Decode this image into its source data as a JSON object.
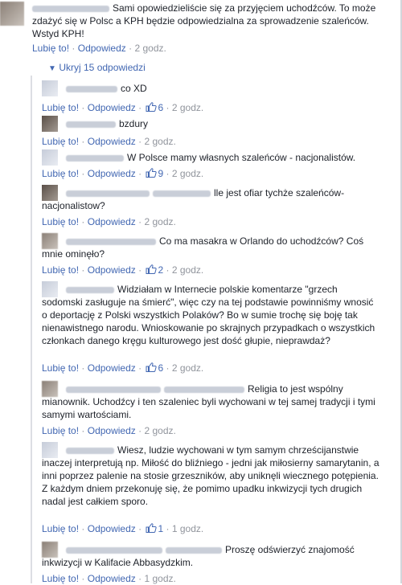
{
  "top_comment": {
    "text": "Sami opowiedzieliście się za przyjęciem uchodźców. To może zdażyć się w Polsc a KPH będzie odpowiedzialna za sprowadzenie szaleńców. Wstyd KPH!",
    "like": "Lubię to!",
    "reply": "Odpowiedz",
    "time": "2 godz."
  },
  "toggle": {
    "label": "Ukryj 15 odpowiedzi"
  },
  "actions": {
    "like": "Lubię to!",
    "reply": "Odpowiedz",
    "separator": "·"
  },
  "replies": [
    {
      "text": "co XD",
      "likes": "6",
      "time": "2 godz."
    },
    {
      "text": "bzdury",
      "likes": "",
      "time": "2 godz."
    },
    {
      "text": "W Polsce mamy własnych szaleńców - nacjonalistów.",
      "likes": "9",
      "time": "2 godz."
    },
    {
      "text": "lle jest ofiar tychże szaleńców-nacjonalistow?",
      "likes": "",
      "time": "2 godz."
    },
    {
      "text": "Co ma masakra w Orlando do uchodźców? Coś mnie ominęło?",
      "likes": "2",
      "time": "2 godz."
    },
    {
      "text": "Widziałam w Internecie polskie komentarze \"grzech sodomski zasługuje na śmierć\", więc czy na tej podstawie powinniśmy wnosić o deportację z Polski wszystkich Polaków? Bo w sumie trochę się boję tak nienawistnego narodu. Wnioskowanie po skrajnych przypadkach o wszystkich członkach danego kręgu kulturowego jest dość głupie, nieprawdaż?",
      "likes": "6",
      "time": "2 godz."
    },
    {
      "text": "Religia to jest wspólny mianownik. Uchodźcy i ten szaleniec byli wychowani w tej samej tradycji i tymi samymi wartościami.",
      "likes": "",
      "time": "2 godz."
    },
    {
      "text": "Wiesz, ludzie wychowani w tym samym chrześcijanstwie inaczej interpretują np. Miłość do bliźniego - jedni jak miłosierny samarytanin, a inni poprzez palenie na stosie grzeszników, aby uniknęli wiecznego potępienia. Z każdym dniem przekonuję się, że pomimo upadku inkwizycji tych drugich nadal jest całkiem sporo.",
      "likes": "1",
      "time": "1 godz."
    },
    {
      "text": "Proszę odświerzyć znajomość inkwizycji w Kalifacie Abbasydzkim.",
      "likes": "",
      "time": "1 godz."
    }
  ],
  "colors": {
    "link": "#4267b2",
    "meta": "#90949c",
    "text": "#1d2129",
    "thread_line": "#dcdee3"
  },
  "icons": {
    "like": "thumbs-up-icon",
    "toggle": "chevron-down-icon"
  }
}
